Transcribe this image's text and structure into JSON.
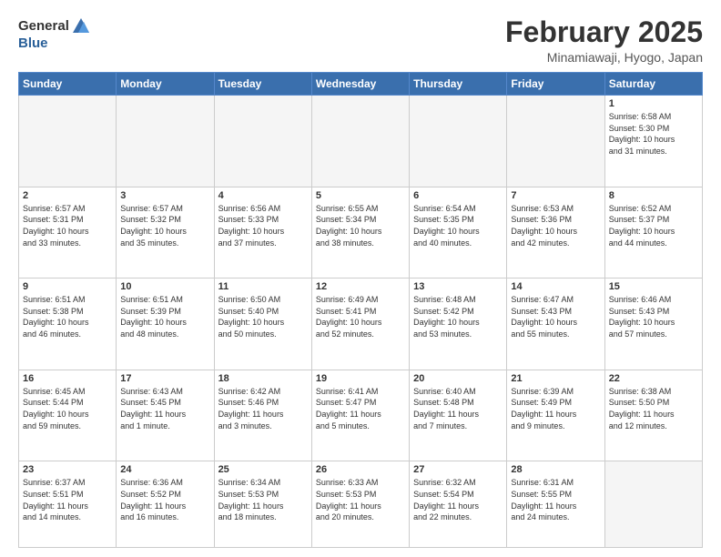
{
  "header": {
    "logo_general": "General",
    "logo_blue": "Blue",
    "month_title": "February 2025",
    "location": "Minamiawaji, Hyogo, Japan"
  },
  "weekdays": [
    "Sunday",
    "Monday",
    "Tuesday",
    "Wednesday",
    "Thursday",
    "Friday",
    "Saturday"
  ],
  "weeks": [
    [
      {
        "day": "",
        "info": ""
      },
      {
        "day": "",
        "info": ""
      },
      {
        "day": "",
        "info": ""
      },
      {
        "day": "",
        "info": ""
      },
      {
        "day": "",
        "info": ""
      },
      {
        "day": "",
        "info": ""
      },
      {
        "day": "1",
        "info": "Sunrise: 6:58 AM\nSunset: 5:30 PM\nDaylight: 10 hours\nand 31 minutes."
      }
    ],
    [
      {
        "day": "2",
        "info": "Sunrise: 6:57 AM\nSunset: 5:31 PM\nDaylight: 10 hours\nand 33 minutes."
      },
      {
        "day": "3",
        "info": "Sunrise: 6:57 AM\nSunset: 5:32 PM\nDaylight: 10 hours\nand 35 minutes."
      },
      {
        "day": "4",
        "info": "Sunrise: 6:56 AM\nSunset: 5:33 PM\nDaylight: 10 hours\nand 37 minutes."
      },
      {
        "day": "5",
        "info": "Sunrise: 6:55 AM\nSunset: 5:34 PM\nDaylight: 10 hours\nand 38 minutes."
      },
      {
        "day": "6",
        "info": "Sunrise: 6:54 AM\nSunset: 5:35 PM\nDaylight: 10 hours\nand 40 minutes."
      },
      {
        "day": "7",
        "info": "Sunrise: 6:53 AM\nSunset: 5:36 PM\nDaylight: 10 hours\nand 42 minutes."
      },
      {
        "day": "8",
        "info": "Sunrise: 6:52 AM\nSunset: 5:37 PM\nDaylight: 10 hours\nand 44 minutes."
      }
    ],
    [
      {
        "day": "9",
        "info": "Sunrise: 6:51 AM\nSunset: 5:38 PM\nDaylight: 10 hours\nand 46 minutes."
      },
      {
        "day": "10",
        "info": "Sunrise: 6:51 AM\nSunset: 5:39 PM\nDaylight: 10 hours\nand 48 minutes."
      },
      {
        "day": "11",
        "info": "Sunrise: 6:50 AM\nSunset: 5:40 PM\nDaylight: 10 hours\nand 50 minutes."
      },
      {
        "day": "12",
        "info": "Sunrise: 6:49 AM\nSunset: 5:41 PM\nDaylight: 10 hours\nand 52 minutes."
      },
      {
        "day": "13",
        "info": "Sunrise: 6:48 AM\nSunset: 5:42 PM\nDaylight: 10 hours\nand 53 minutes."
      },
      {
        "day": "14",
        "info": "Sunrise: 6:47 AM\nSunset: 5:43 PM\nDaylight: 10 hours\nand 55 minutes."
      },
      {
        "day": "15",
        "info": "Sunrise: 6:46 AM\nSunset: 5:43 PM\nDaylight: 10 hours\nand 57 minutes."
      }
    ],
    [
      {
        "day": "16",
        "info": "Sunrise: 6:45 AM\nSunset: 5:44 PM\nDaylight: 10 hours\nand 59 minutes."
      },
      {
        "day": "17",
        "info": "Sunrise: 6:43 AM\nSunset: 5:45 PM\nDaylight: 11 hours\nand 1 minute."
      },
      {
        "day": "18",
        "info": "Sunrise: 6:42 AM\nSunset: 5:46 PM\nDaylight: 11 hours\nand 3 minutes."
      },
      {
        "day": "19",
        "info": "Sunrise: 6:41 AM\nSunset: 5:47 PM\nDaylight: 11 hours\nand 5 minutes."
      },
      {
        "day": "20",
        "info": "Sunrise: 6:40 AM\nSunset: 5:48 PM\nDaylight: 11 hours\nand 7 minutes."
      },
      {
        "day": "21",
        "info": "Sunrise: 6:39 AM\nSunset: 5:49 PM\nDaylight: 11 hours\nand 9 minutes."
      },
      {
        "day": "22",
        "info": "Sunrise: 6:38 AM\nSunset: 5:50 PM\nDaylight: 11 hours\nand 12 minutes."
      }
    ],
    [
      {
        "day": "23",
        "info": "Sunrise: 6:37 AM\nSunset: 5:51 PM\nDaylight: 11 hours\nand 14 minutes."
      },
      {
        "day": "24",
        "info": "Sunrise: 6:36 AM\nSunset: 5:52 PM\nDaylight: 11 hours\nand 16 minutes."
      },
      {
        "day": "25",
        "info": "Sunrise: 6:34 AM\nSunset: 5:53 PM\nDaylight: 11 hours\nand 18 minutes."
      },
      {
        "day": "26",
        "info": "Sunrise: 6:33 AM\nSunset: 5:53 PM\nDaylight: 11 hours\nand 20 minutes."
      },
      {
        "day": "27",
        "info": "Sunrise: 6:32 AM\nSunset: 5:54 PM\nDaylight: 11 hours\nand 22 minutes."
      },
      {
        "day": "28",
        "info": "Sunrise: 6:31 AM\nSunset: 5:55 PM\nDaylight: 11 hours\nand 24 minutes."
      },
      {
        "day": "",
        "info": ""
      }
    ]
  ]
}
